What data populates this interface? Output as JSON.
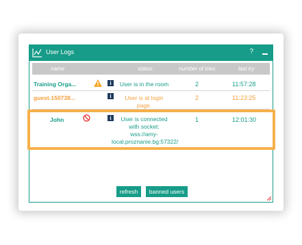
{
  "window": {
    "title": "User Logs",
    "help_label": "?"
  },
  "table": {
    "headers": {
      "name": "name",
      "status": "status:",
      "tries": "number of tries",
      "last": "last try"
    },
    "rows": [
      {
        "name": "Training Orga...",
        "warning_icon": "warning-icon",
        "info": "i",
        "status_lines": [
          "User is in the room"
        ],
        "tries": "2",
        "last": "11:57:28"
      },
      {
        "name": "guest-150738...",
        "info": "i",
        "status_lines": [
          "User is at login",
          "page."
        ],
        "tries": "2",
        "last": "11:23:25"
      },
      {
        "name": "John",
        "blocked_icon": "blocked-icon",
        "info": "i",
        "status_lines": [
          "User is connected",
          "with socket:",
          "wss://amy-",
          "local.proznanie.bg:57322/"
        ],
        "tries": "1",
        "last": "12:01:30"
      }
    ]
  },
  "buttons": {
    "refresh": "refresh",
    "banned": "banned users"
  },
  "colors": {
    "accent": "#169c88",
    "orange": "#f5a03d",
    "highlight": "#f6b04a",
    "info_icon": "#1e3a5c",
    "blocked": "#e53935"
  }
}
